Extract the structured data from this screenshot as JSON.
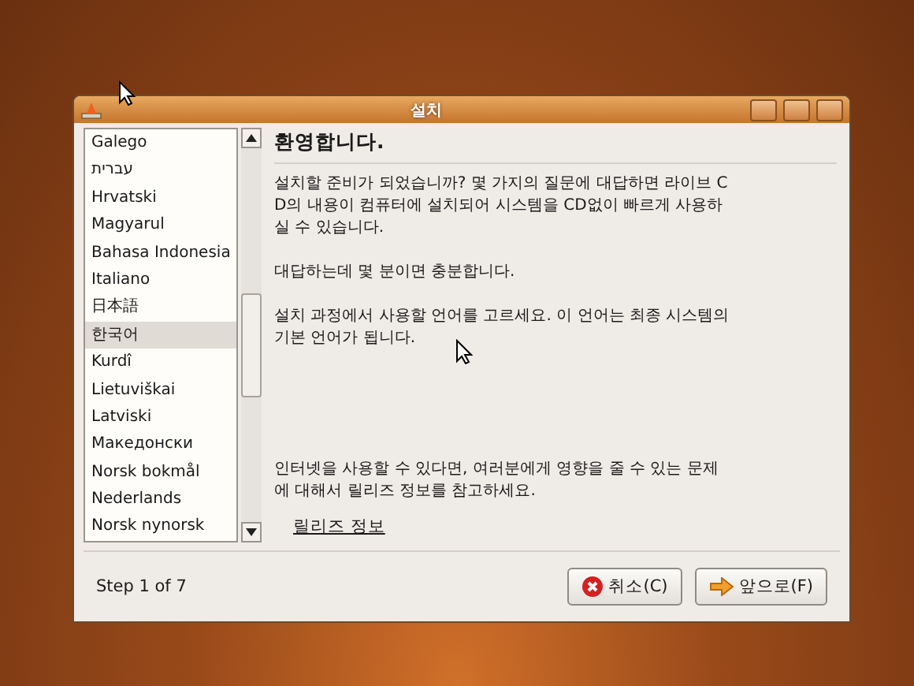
{
  "window": {
    "title": "설치"
  },
  "languages": [
    {
      "label": "Galego",
      "selected": false
    },
    {
      "label": "עברית",
      "selected": false
    },
    {
      "label": "Hrvatski",
      "selected": false
    },
    {
      "label": "Magyarul",
      "selected": false
    },
    {
      "label": "Bahasa Indonesia",
      "selected": false
    },
    {
      "label": "Italiano",
      "selected": false
    },
    {
      "label": "日本語",
      "selected": false
    },
    {
      "label": "한국어",
      "selected": true
    },
    {
      "label": "Kurdî",
      "selected": false
    },
    {
      "label": "Lietuviškai",
      "selected": false
    },
    {
      "label": "Latviski",
      "selected": false
    },
    {
      "label": "Македонски",
      "selected": false
    },
    {
      "label": "Norsk bokmål",
      "selected": false
    },
    {
      "label": "Nederlands",
      "selected": false
    },
    {
      "label": "Norsk nynorsk",
      "selected": false
    }
  ],
  "heading": "환영합니다.",
  "paragraphs": [
    "설치할 준비가 되었습니까? 몇 가지의 질문에 대답하면 라이브 CD의 내용이 컴퓨터에 설치되어 시스템을 CD없이 빠르게 사용하실 수 있습니다.",
    "대답하는데 몇 분이면 충분합니다.",
    "설치 과정에서 사용할 언어를 고르세요. 이 언어는 최종 시스템의 기본 언어가 됩니다."
  ],
  "note": "인터넷을 사용할 수 있다면, 여러분에게 영향을 줄 수 있는 문제에 대해서 릴리즈 정보를 참고하세요.",
  "link": "릴리즈 정보",
  "step": "Step 1 of 7",
  "buttons": [
    {
      "kind": "cancel",
      "label": "취소(C)"
    },
    {
      "kind": "forward",
      "label": "앞으로(F)"
    }
  ]
}
